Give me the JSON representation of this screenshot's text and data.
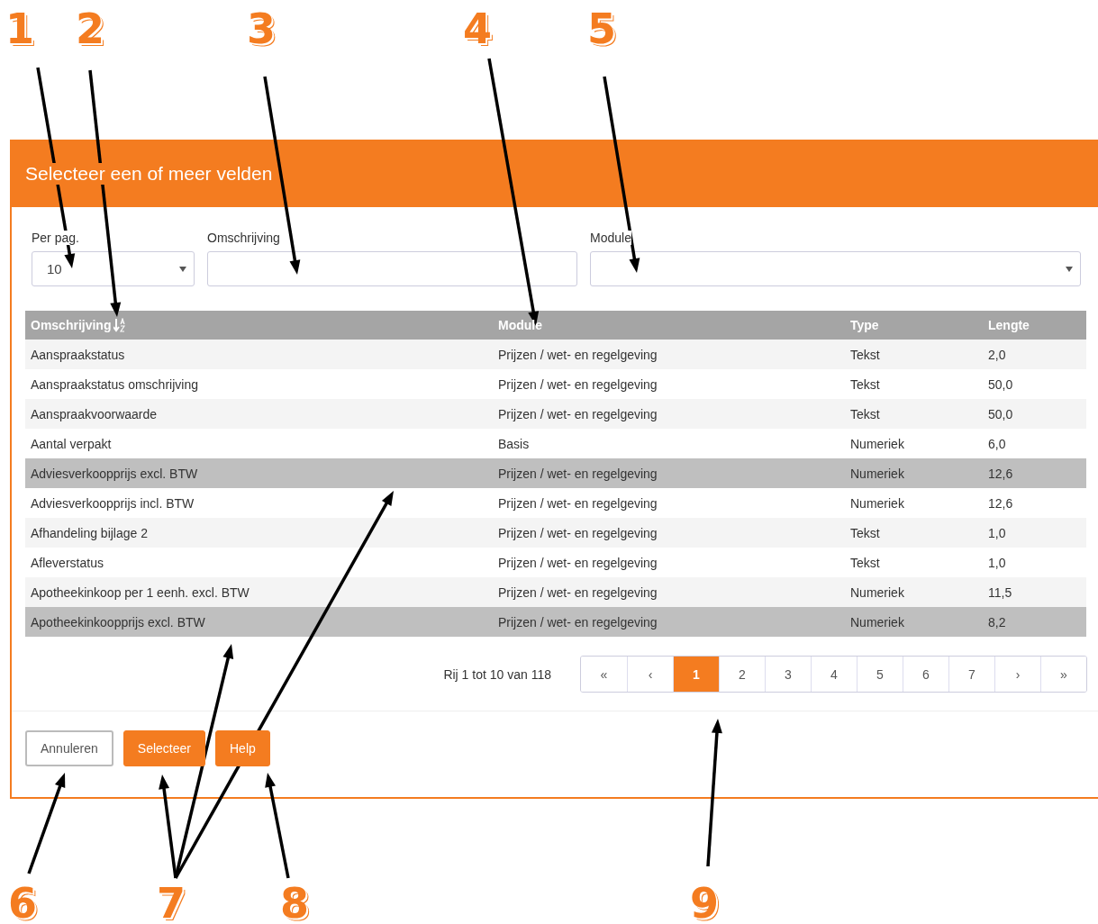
{
  "dialog": {
    "title": "Selecteer een of meer velden"
  },
  "filters": {
    "per_page": {
      "label": "Per pag.",
      "value": "10"
    },
    "description": {
      "label": "Omschrijving"
    },
    "module": {
      "label": "Module"
    }
  },
  "table": {
    "columns": [
      {
        "label": "Omschrijving",
        "sorted": true
      },
      {
        "label": "Module",
        "sorted": false
      },
      {
        "label": "Type",
        "sorted": false
      },
      {
        "label": "Lengte",
        "sorted": false
      }
    ],
    "rows": [
      {
        "cells": [
          "Aanspraakstatus",
          "Prijzen / wet- en regelgeving",
          "Tekst",
          "2,0"
        ],
        "selected": false
      },
      {
        "cells": [
          "Aanspraakstatus omschrijving",
          "Prijzen / wet- en regelgeving",
          "Tekst",
          "50,0"
        ],
        "selected": false
      },
      {
        "cells": [
          "Aanspraakvoorwaarde",
          "Prijzen / wet- en regelgeving",
          "Tekst",
          "50,0"
        ],
        "selected": false
      },
      {
        "cells": [
          "Aantal verpakt",
          "Basis",
          "Numeriek",
          "6,0"
        ],
        "selected": false
      },
      {
        "cells": [
          "Adviesverkoopprijs excl. BTW",
          "Prijzen / wet- en regelgeving",
          "Numeriek",
          "12,6"
        ],
        "selected": true
      },
      {
        "cells": [
          "Adviesverkoopprijs incl. BTW",
          "Prijzen / wet- en regelgeving",
          "Numeriek",
          "12,6"
        ],
        "selected": false
      },
      {
        "cells": [
          "Afhandeling bijlage 2",
          "Prijzen / wet- en regelgeving",
          "Tekst",
          "1,0"
        ],
        "selected": false
      },
      {
        "cells": [
          "Afleverstatus",
          "Prijzen / wet- en regelgeving",
          "Tekst",
          "1,0"
        ],
        "selected": false
      },
      {
        "cells": [
          "Apotheekinkoop per 1 eenh. excl. BTW",
          "Prijzen / wet- en regelgeving",
          "Numeriek",
          "11,5"
        ],
        "selected": false
      },
      {
        "cells": [
          "Apotheekinkoopprijs excl. BTW",
          "Prijzen / wet- en regelgeving",
          "Numeriek",
          "8,2"
        ],
        "selected": true
      }
    ]
  },
  "pagination": {
    "summary": "Rij 1 tot 10 van 118",
    "pages": [
      {
        "label": "«",
        "selected": false
      },
      {
        "label": "‹",
        "selected": false
      },
      {
        "label": "1",
        "selected": true
      },
      {
        "label": "2",
        "selected": false
      },
      {
        "label": "3",
        "selected": false
      },
      {
        "label": "4",
        "selected": false
      },
      {
        "label": "5",
        "selected": false
      },
      {
        "label": "6",
        "selected": false
      },
      {
        "label": "7",
        "selected": false
      },
      {
        "label": "›",
        "selected": false
      },
      {
        "label": "»",
        "selected": false
      }
    ]
  },
  "buttons": [
    {
      "label": "Annuleren",
      "kind": "secondary"
    },
    {
      "label": "Selecteer",
      "kind": "primary"
    },
    {
      "label": "Help",
      "kind": "primary"
    }
  ],
  "annotations": [
    {
      "number": "1"
    },
    {
      "number": "2"
    },
    {
      "number": "3"
    },
    {
      "number": "4"
    },
    {
      "number": "5"
    },
    {
      "number": "6"
    },
    {
      "number": "7"
    },
    {
      "number": "8"
    },
    {
      "number": "9"
    }
  ]
}
